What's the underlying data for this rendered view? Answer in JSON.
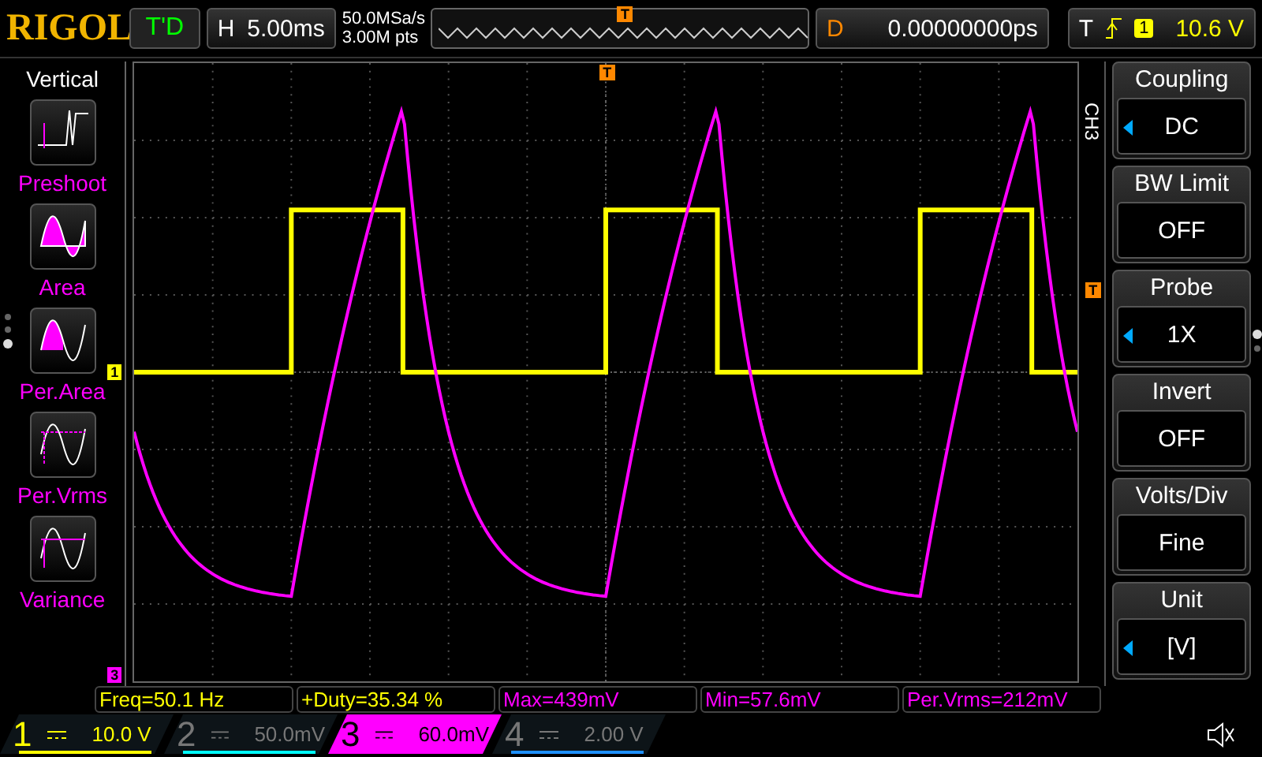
{
  "top_bar": {
    "brand": "RIGOL",
    "run_status": "T'D",
    "timebase": {
      "label": "H",
      "value": "5.00ms"
    },
    "sample_rate": "50.0MSa/s",
    "memory_depth": "3.00M pts",
    "trigger_position_marker": "T",
    "delay": {
      "label": "D",
      "value": "0.00000000ps"
    },
    "trigger": {
      "label": "T",
      "source": "1",
      "level": "10.6 V"
    }
  },
  "left_menu": {
    "title": "Vertical",
    "items": [
      {
        "label": "Preshoot",
        "kind": "preshoot"
      },
      {
        "label": "Area",
        "kind": "area"
      },
      {
        "label": "Per.Area",
        "kind": "per_area"
      },
      {
        "label": "Per.Vrms",
        "kind": "per_vrms"
      },
      {
        "label": "Variance",
        "kind": "variance"
      }
    ],
    "pages": [
      {
        "selected": false
      },
      {
        "selected": false
      },
      {
        "selected": true
      }
    ]
  },
  "graticule": {
    "trigger_marker": "T",
    "channel_1_marker": "1",
    "trigger_level_marker": "T",
    "channel_3_marker": "3"
  },
  "right_menu": {
    "channel_label": "CH3",
    "items": [
      {
        "title": "Coupling",
        "value": "DC",
        "arrow": true
      },
      {
        "title": "BW Limit",
        "value": "OFF",
        "arrow": false
      },
      {
        "title": "Probe",
        "value": "1X",
        "arrow": true
      },
      {
        "title": "Invert",
        "value": "OFF",
        "arrow": false
      },
      {
        "title": "Volts/Div",
        "value": "Fine",
        "arrow": false
      },
      {
        "title": "Unit",
        "value": "[V]",
        "arrow": true
      }
    ],
    "pages": [
      {
        "selected": true
      },
      {
        "selected": false
      }
    ]
  },
  "measurements": [
    {
      "text": "Freq=50.1 Hz",
      "color": "#ffff00"
    },
    {
      "text": "+Duty=35.34 %",
      "color": "#ffff00"
    },
    {
      "text": "Max=439mV",
      "color": "#ff00ff"
    },
    {
      "text": "Min=57.6mV",
      "color": "#ff00ff"
    },
    {
      "text": "Per.Vrms=212mV",
      "color": "#ff00ff"
    }
  ],
  "channels": [
    {
      "number": "1",
      "scale": "10.0 V",
      "on": true,
      "selected": false,
      "color": "#ffff00"
    },
    {
      "number": "2",
      "scale": "50.0mV",
      "on": false,
      "selected": false,
      "color": "#00ffff"
    },
    {
      "number": "3",
      "scale": "60.0mV",
      "on": true,
      "selected": true,
      "color": "#ff00ff"
    },
    {
      "number": "4",
      "scale": "2.00 V",
      "on": false,
      "selected": false,
      "color": "#1e90ff"
    }
  ]
}
